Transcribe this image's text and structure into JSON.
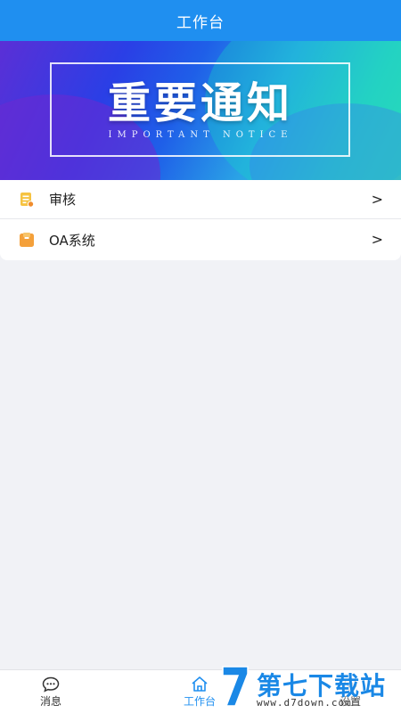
{
  "header": {
    "title": "工作台"
  },
  "banner": {
    "title": "重要通知",
    "subtitle": "IMPORTANT NOTICE"
  },
  "menu": {
    "items": [
      {
        "label": "审核",
        "icon": "document-audit-icon",
        "icon_color": "#f6c342",
        "arrow": ">"
      },
      {
        "label": "OA系统",
        "icon": "folder-icon",
        "icon_color": "#f4a03a",
        "arrow": ">"
      }
    ]
  },
  "tabbar": {
    "tabs": [
      {
        "label": "消息",
        "icon": "chat-bubble-icon"
      },
      {
        "label": "工作台",
        "icon": "home-icon",
        "active": true
      },
      {
        "label": "设置",
        "icon": "settings-icon"
      }
    ]
  },
  "watermark": {
    "text": "第七下载站",
    "url": "www.d7down.com"
  },
  "colors": {
    "primary": "#1f8ff0",
    "background": "#f1f2f6"
  }
}
